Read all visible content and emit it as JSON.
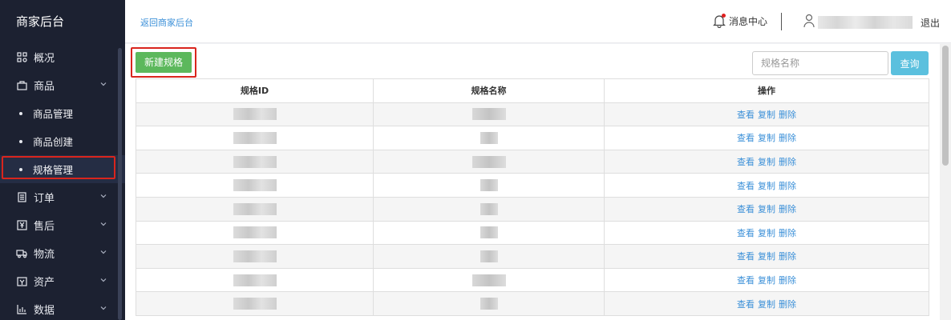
{
  "sidebar": {
    "brand": "商家后台",
    "items": [
      {
        "label": "概况",
        "icon": "grid-icon"
      },
      {
        "label": "商品",
        "icon": "bag-icon"
      },
      {
        "label": "商品管理"
      },
      {
        "label": "商品创建"
      },
      {
        "label": "规格管理"
      },
      {
        "label": "订单",
        "icon": "document-icon"
      },
      {
        "label": "售后",
        "icon": "yen-icon"
      },
      {
        "label": "物流",
        "icon": "truck-icon"
      },
      {
        "label": "资产",
        "icon": "wallet-icon"
      },
      {
        "label": "数据",
        "icon": "bar-chart-icon"
      }
    ]
  },
  "topbar": {
    "back_link": "返回商家后台",
    "notifications": "消息中心",
    "logout": "退出"
  },
  "toolbar": {
    "new_spec_button": "新建规格",
    "search_placeholder": "规格名称",
    "search_button": "查询"
  },
  "table": {
    "columns": [
      "规格ID",
      "规格名称",
      "操作"
    ],
    "actions": [
      "查看",
      "复制",
      "删除"
    ],
    "row_count": 9
  },
  "colors": {
    "sidebar_bg": "#1c2131",
    "primary_green": "#5cb85c",
    "info_blue": "#5bc0de",
    "link_blue": "#3a8fd8",
    "highlight_red": "#d9251d"
  }
}
